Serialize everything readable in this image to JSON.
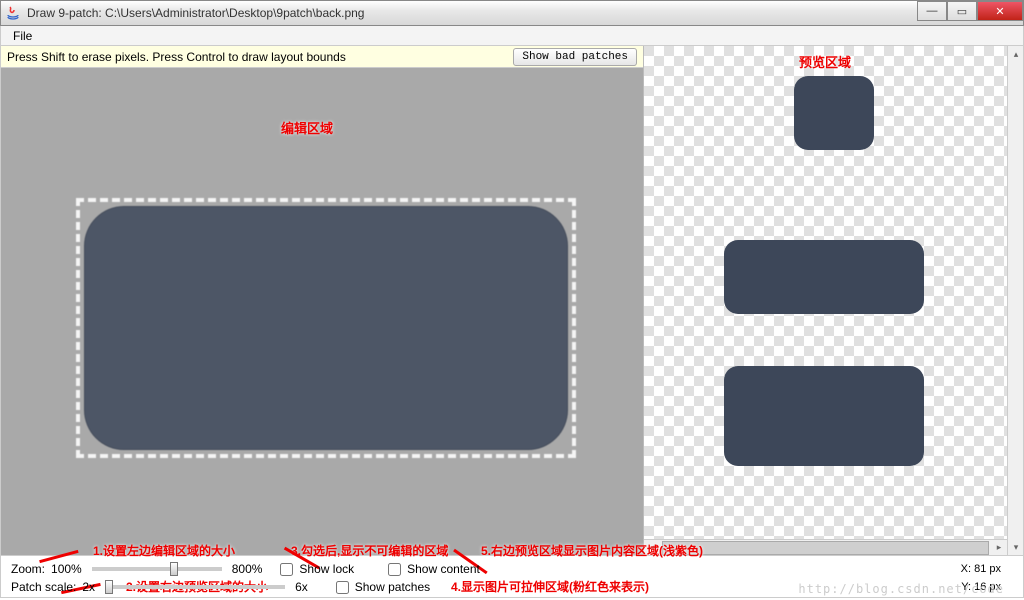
{
  "window": {
    "title": "Draw 9-patch: C:\\Users\\Administrator\\Desktop\\9patch\\back.png"
  },
  "menu": {
    "file": "File"
  },
  "infobar": {
    "hint": "Press Shift to erase pixels. Press Control to draw layout bounds",
    "button": "Show bad patches"
  },
  "annotations": {
    "edit_area": "编辑区域",
    "preview_area": "预览区域",
    "a1": "1.设置左边编辑区域的大小",
    "a2": "2.设置右边预览区域的大小",
    "a3": "3.勾选后,显示不可编辑的区域",
    "a4": "4.显示图片可拉伸区域(粉红色来表示)",
    "a5": "5.右边预览区域显示图片内容区域(浅紫色)"
  },
  "controls": {
    "zoom_label": "Zoom:",
    "zoom_min": "100%",
    "zoom_max": "800%",
    "patch_label": "Patch scale:",
    "patch_min": "2x",
    "patch_max": "6x",
    "show_lock": "Show lock",
    "show_patches": "Show patches",
    "show_content": "Show content",
    "x_label": "X: 81 px",
    "y_label": "Y: 16 px"
  },
  "watermark": "http://blog.csdn.net/code"
}
